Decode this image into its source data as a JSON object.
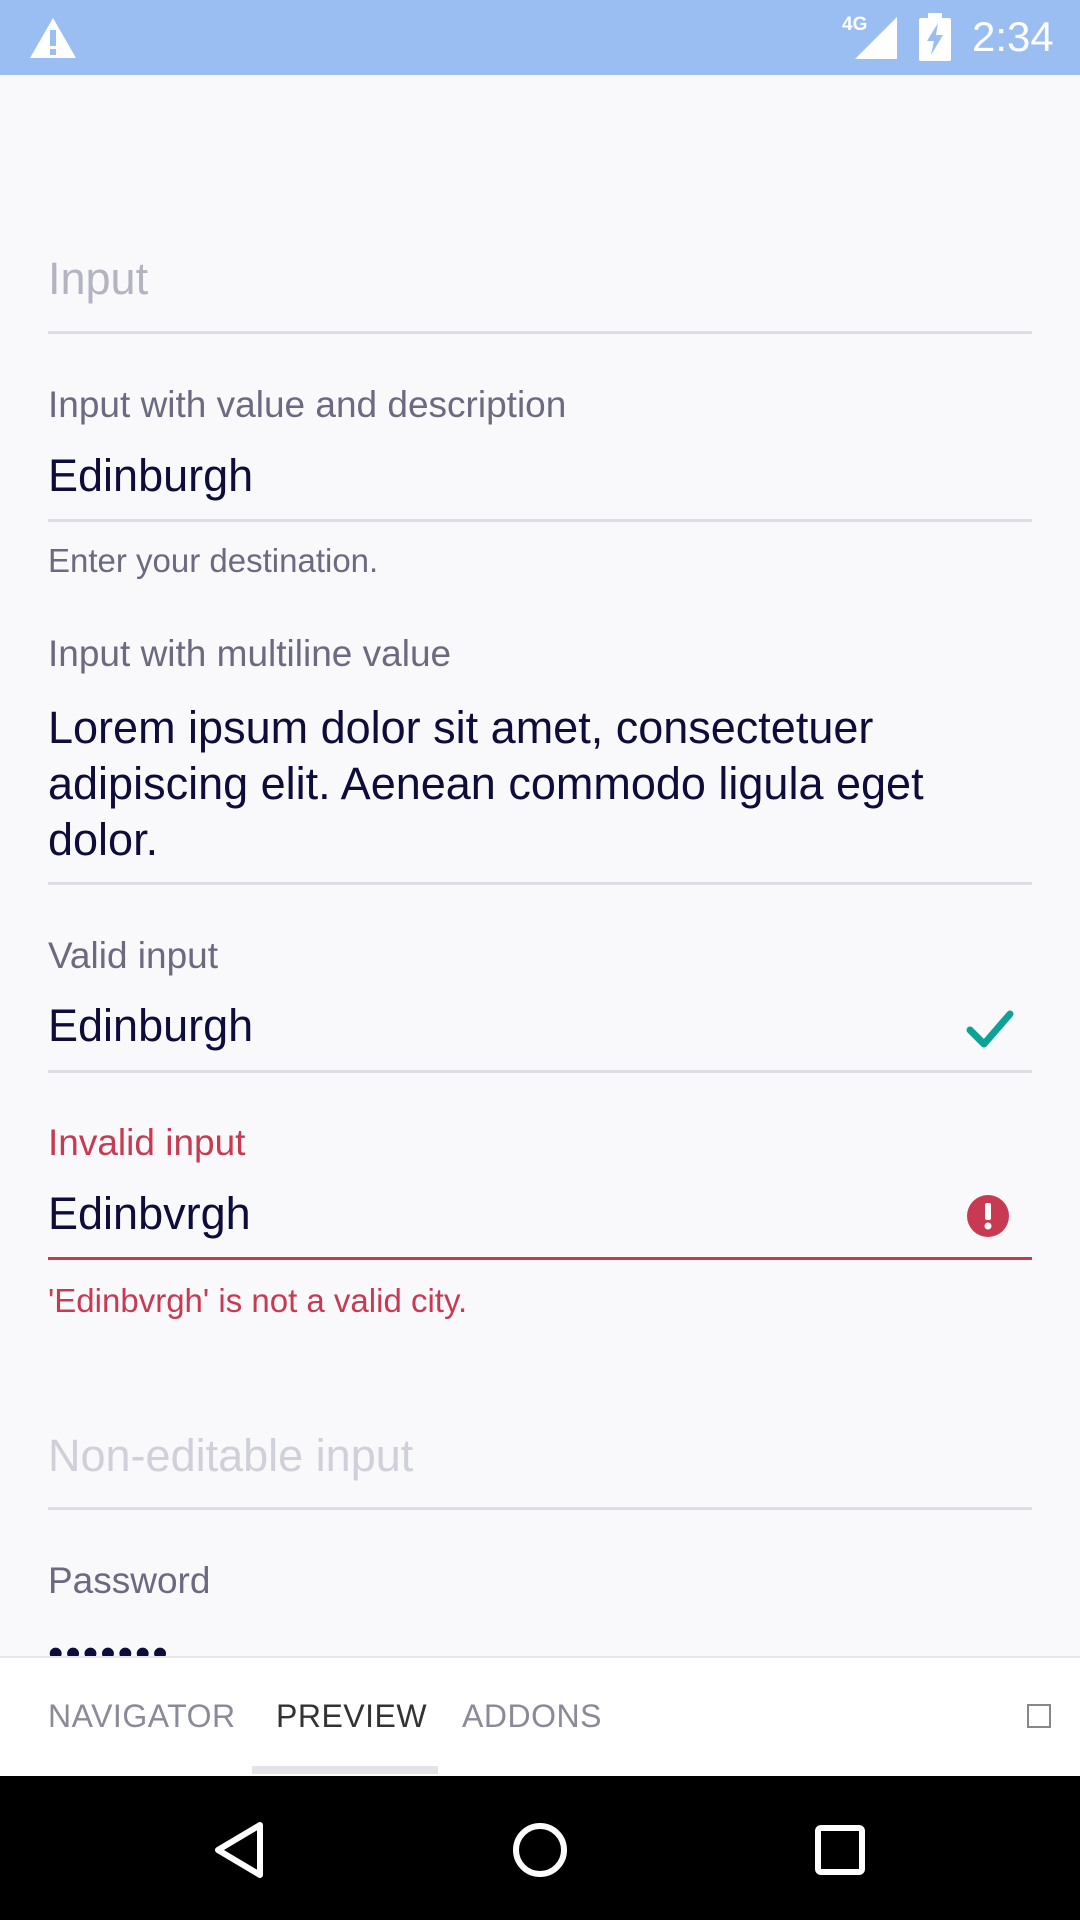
{
  "status_bar": {
    "network": "4G",
    "time": "2:34",
    "icons": [
      "warning-icon",
      "cell-signal-icon",
      "battery-charging-icon"
    ]
  },
  "form": {
    "input_placeholder": "Input",
    "desc_field": {
      "label": "Input with value and description",
      "value": "Edinburgh",
      "description": "Enter your destination."
    },
    "multiline_field": {
      "label": "Input with multiline value",
      "value_line1": "Lorem ipsum dolor sit amet, consectetuer",
      "value_line2": "adipiscing elit. Aenean commodo ligula eget",
      "value_line3": "dolor."
    },
    "valid_field": {
      "label": "Valid input",
      "value": "Edinburgh",
      "status_icon": "check-icon"
    },
    "invalid_field": {
      "label": "Invalid input",
      "value": "Edinbvrgh",
      "error": "'Edinbvrgh' is not a valid city.",
      "status_icon": "alert-circle-icon"
    },
    "noneditable_placeholder": "Non-editable input",
    "password_field": {
      "label": "Password",
      "value": "•••••••"
    }
  },
  "tabs": [
    {
      "label": "NAVIGATOR",
      "active": false
    },
    {
      "label": "PREVIEW",
      "active": true
    },
    {
      "label": "ADDONS",
      "active": false
    }
  ],
  "colors": {
    "status_bar": "#9bbef2",
    "valid": "#0ca297",
    "error": "#c83a52",
    "text": "#0e0c3a",
    "label": "#6b6a80"
  }
}
